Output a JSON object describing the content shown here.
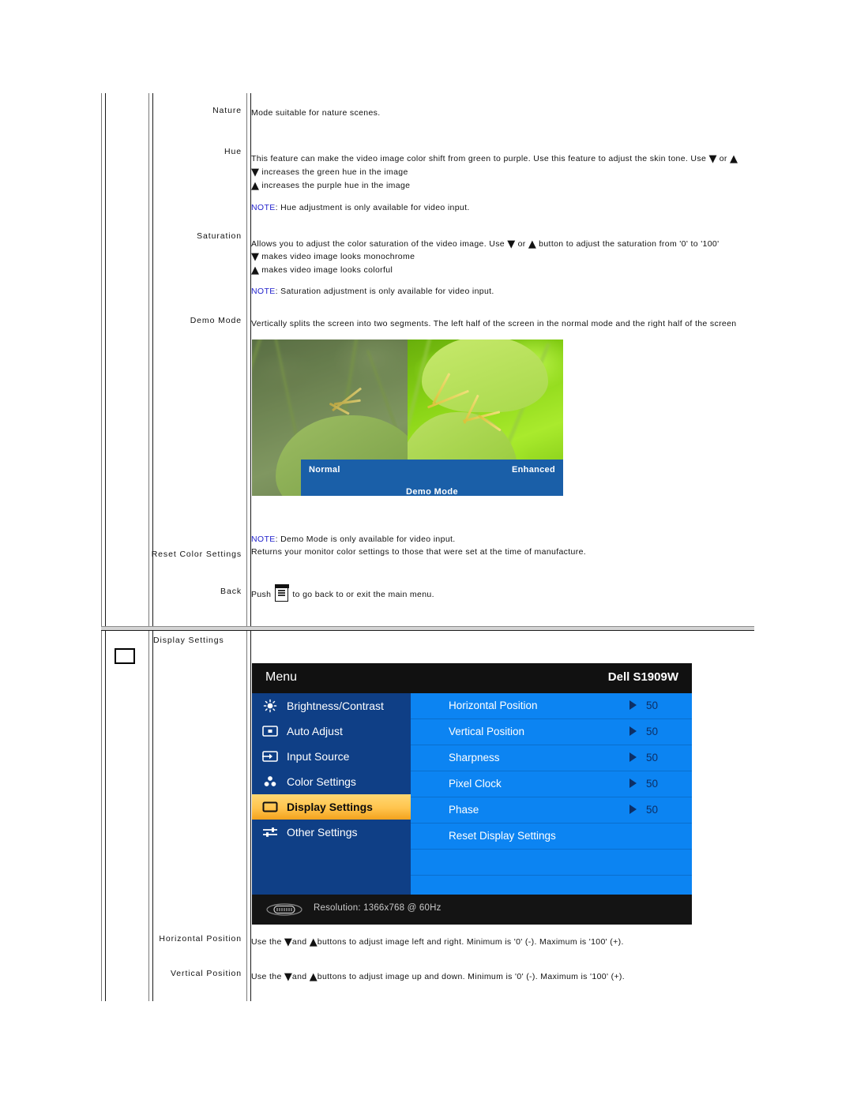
{
  "doc": {
    "rows": [
      {
        "label": "Nature",
        "lines": [
          {
            "type": "plain",
            "text": "Mode suitable for nature scenes."
          }
        ]
      },
      {
        "label": "Hue",
        "lines": [
          {
            "type": "plain",
            "text": "This feature can make the video image color shift from green to purple. Use this feature to adjust the skin tone. Use"
          },
          {
            "type": "plain",
            "text": "increases the green hue in the image"
          },
          {
            "type": "plain",
            "text": "increases the purple hue in the image"
          },
          {
            "type": "note",
            "prefix": "NOTE",
            "text": ": Hue adjustment is only available for video input."
          }
        ]
      },
      {
        "label": "Saturation",
        "lines": [
          {
            "type": "plain",
            "text": "Allows you to adjust the color saturation of the video image. Use"
          },
          {
            "type": "plain",
            "text": "button to adjust the saturation from '0' to '100'"
          },
          {
            "type": "plain",
            "text": "makes video image looks monochrome"
          },
          {
            "type": "plain",
            "text": "makes video image looks colorful"
          },
          {
            "type": "note",
            "prefix": "NOTE",
            "text": ": Saturation adjustment is only available for video input."
          }
        ]
      },
      {
        "label": "Demo Mode",
        "lines": [
          {
            "type": "plain",
            "text": "Vertically splits the screen into two segments. The left half of the screen in the normal mode and the right half of the screen"
          },
          {
            "type": "note",
            "prefix": "NOTE",
            "text": ": Demo Mode is only available for video input."
          }
        ]
      },
      {
        "label": "Reset Color Settings",
        "lines": [
          {
            "type": "plain",
            "text": "Returns your monitor color settings to those that were set at the time of manufacture."
          }
        ]
      },
      {
        "label": "Back",
        "lines": [
          {
            "type": "plain",
            "text": "Push"
          },
          {
            "type": "plain",
            "text": "to go back to or exit the main menu."
          }
        ]
      },
      {
        "label": "Display Settings",
        "lines": []
      },
      {
        "label": "Horizontal Position",
        "lines": [
          {
            "type": "plain",
            "text": "Use the"
          },
          {
            "type": "plain",
            "text": "and"
          },
          {
            "type": "plain",
            "text": "buttons to adjust image left and right. Minimum is '0' (-). Maximum is '100' (+)."
          }
        ]
      },
      {
        "label": "Vertical Position",
        "lines": [
          {
            "type": "plain",
            "text": "Use the"
          },
          {
            "type": "plain",
            "text": "and"
          },
          {
            "type": "plain",
            "text": "buttons to adjust image up and down. Minimum is '0' (-). Maximum is '100' (+)."
          }
        ]
      }
    ],
    "labels": {
      "nature": "Nature",
      "hue": "Hue",
      "saturation": "Saturation",
      "demo_mode": "Demo Mode",
      "reset_color_settings": "Reset Color Settings",
      "back": "Back",
      "display_settings": "Display Settings",
      "horizontal_position": "Horizontal Position",
      "vertical_position": "Vertical Position"
    },
    "text": {
      "nature_desc": "Mode suitable for nature scenes.",
      "hue_main_a": "This feature can make the video image color shift from green to purple. Use this feature to adjust the skin tone. Use",
      "hue_main_or": "or",
      "hue_down": "increases the green hue in the image",
      "hue_up": "increases the purple hue in the image",
      "hue_note_prefix": "NOTE",
      "hue_note": ": Hue adjustment is only available for video input.",
      "sat_main_a": "Allows you to adjust the color saturation of the video image. Use",
      "sat_main_or": "or",
      "sat_main_b": "button to adjust the saturation from '0' to '100'",
      "sat_down": "makes video image looks monochrome",
      "sat_up": "makes video image looks colorful",
      "sat_note_prefix": "NOTE",
      "sat_note": ": Saturation adjustment is only available for video input.",
      "demo_desc": "Vertically splits the screen into two segments. The left half of the screen in the normal mode and the right half of the screen",
      "demo_note_prefix": "NOTE",
      "demo_note": ": Demo Mode is only available for video input.",
      "reset_desc": "Returns your monitor color settings to those that were set at the time of manufacture.",
      "back_push": "Push",
      "back_rest": "to go back to or exit the main menu.",
      "hpos_a": "Use the",
      "hpos_and": "and",
      "hpos_b": "buttons to adjust image left and right. Minimum is '0' (-). Maximum is '100' (+).",
      "vpos_a": "Use the",
      "vpos_and": "and",
      "vpos_b": "buttons to adjust image up and down. Minimum is '0' (-). Maximum is '100' (+)."
    }
  },
  "demo_figure": {
    "caption_normal": "Normal",
    "caption_enhanced": "Enhanced",
    "caption_title": "Demo Mode",
    "banner_color": "#1a5fa8"
  },
  "osd": {
    "title": "Menu",
    "model": "Dell S1909W",
    "menu_items": [
      {
        "label": "Brightness/Contrast",
        "icon": "brightness-icon",
        "selected": false
      },
      {
        "label": "Auto Adjust",
        "icon": "auto-adjust-icon",
        "selected": false
      },
      {
        "label": "Input Source",
        "icon": "input-source-icon",
        "selected": false
      },
      {
        "label": "Color Settings",
        "icon": "color-settings-icon",
        "selected": false
      },
      {
        "label": "Display Settings",
        "icon": "display-settings-icon",
        "selected": true
      },
      {
        "label": "Other Settings",
        "icon": "other-settings-icon",
        "selected": false
      }
    ],
    "sub_items": [
      {
        "label": "Horizontal Position",
        "value": "50",
        "has_arrow": true
      },
      {
        "label": "Vertical Position",
        "value": "50",
        "has_arrow": true
      },
      {
        "label": "Sharpness",
        "value": "50",
        "has_arrow": true
      },
      {
        "label": "Pixel Clock",
        "value": "50",
        "has_arrow": true
      },
      {
        "label": "Phase",
        "value": "50",
        "has_arrow": true
      },
      {
        "label": "Reset Display Settings",
        "value": "",
        "has_arrow": false
      },
      {
        "label": "",
        "value": "",
        "has_arrow": false
      },
      {
        "label": "",
        "value": "",
        "has_arrow": false
      }
    ],
    "footer_text": "Resolution: 1366x768 @ 60Hz",
    "colors": {
      "title_bar": "#111111",
      "left_panel": "#0f3f86",
      "right_panel": "#0c84f2",
      "highlight": "#ffc44d",
      "footer": "#141414"
    }
  }
}
